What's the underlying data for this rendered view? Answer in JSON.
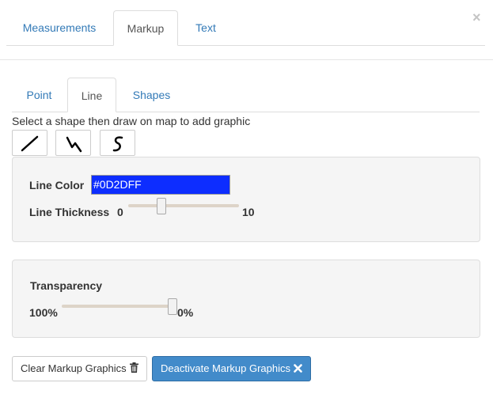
{
  "close_label": "×",
  "main_tabs": [
    {
      "label": "Measurements",
      "active": false
    },
    {
      "label": "Markup",
      "active": true
    },
    {
      "label": "Text",
      "active": false
    }
  ],
  "sub_tabs": [
    {
      "label": "Point",
      "active": false
    },
    {
      "label": "Line",
      "active": true
    },
    {
      "label": "Shapes",
      "active": false
    }
  ],
  "instruction": "Select a shape then draw on map to add graphic",
  "shape_buttons": [
    {
      "icon": "straight-line-icon"
    },
    {
      "icon": "polyline-icon"
    },
    {
      "icon": "freehand-line-icon"
    }
  ],
  "line_settings": {
    "color_label": "Line Color",
    "color_value": "#0D2DFF",
    "thickness_label": "Line Thickness",
    "thickness_min": "0",
    "thickness_max": "10",
    "thickness_value_fraction": 0.3
  },
  "transparency": {
    "label": "Transparency",
    "min_label": "100%",
    "max_label": "0%",
    "value_fraction": 1.0
  },
  "buttons": {
    "clear_label": "Clear Markup Graphics",
    "clear_icon": "trash-icon",
    "deactivate_label": "Deactivate Markup Graphics",
    "deactivate_icon": "close-x-icon"
  },
  "colors": {
    "link": "#337ab7",
    "primary": "#428bca",
    "line_color_swatch": "#0D2DFF"
  }
}
